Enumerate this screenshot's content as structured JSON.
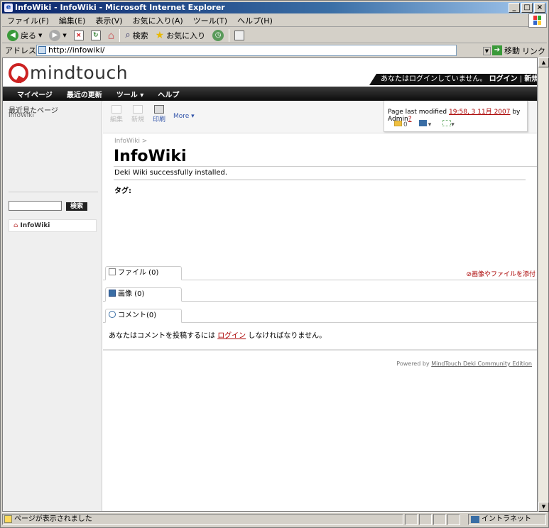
{
  "window": {
    "title": "InfoWiki - InfoWiki - Microsoft Internet Explorer",
    "buttons": [
      "_",
      "□",
      "×"
    ]
  },
  "menubar": [
    "ファイル(F)",
    "編集(E)",
    "表示(V)",
    "お気に入り(A)",
    "ツール(T)",
    "ヘルプ(H)"
  ],
  "toolbar": {
    "back": "戻る",
    "search": "検索",
    "favorites": "お気に入り"
  },
  "address": {
    "label": "アドレス(D)",
    "url": "http://infowiki/",
    "go": "移動",
    "links": "リンク »"
  },
  "site": {
    "logo_text": "mindtouch",
    "login_status": "あなたはログインしていません。",
    "login_link": "ログイン",
    "register_link": "新規登録",
    "nav": [
      "マイページ",
      "最近の更新",
      "ツール ▾",
      "ヘルプ"
    ]
  },
  "sidebar": {
    "recent_title": "最近見たページ",
    "recent_item": "InfoWiki",
    "search_button": "検索",
    "tree_item": "InfoWiki"
  },
  "pagebar": {
    "edit": "編集",
    "new": "新規",
    "print": "印刷",
    "more": "More ▾",
    "modified_prefix": "Page last modified ",
    "modified_time": "19:58, 3 11月 2007",
    "modified_by": " by Admin",
    "modified_suffix": "? ",
    "files_count": "0"
  },
  "page": {
    "breadcrumb": "InfoWiki >",
    "title": "InfoWiki",
    "body": "Deki Wiki successfully installed.",
    "tags_label": "タグ:"
  },
  "sections": {
    "files_tab": "ファイル (0)",
    "attach_link": "画像やファイルを添付",
    "images_tab": "画像 (0)",
    "comments_tab": "コメント(0)",
    "comment_note_prefix": "あなたはコメントを投稿するには ",
    "comment_login": "ログイン",
    "comment_note_suffix": " しなければなりません。"
  },
  "footer": {
    "powered_prefix": "Powered by ",
    "powered_link": "MindTouch Deki Community Edition"
  },
  "status": {
    "text": "ページが表示されました",
    "zone": "イントラネット"
  }
}
